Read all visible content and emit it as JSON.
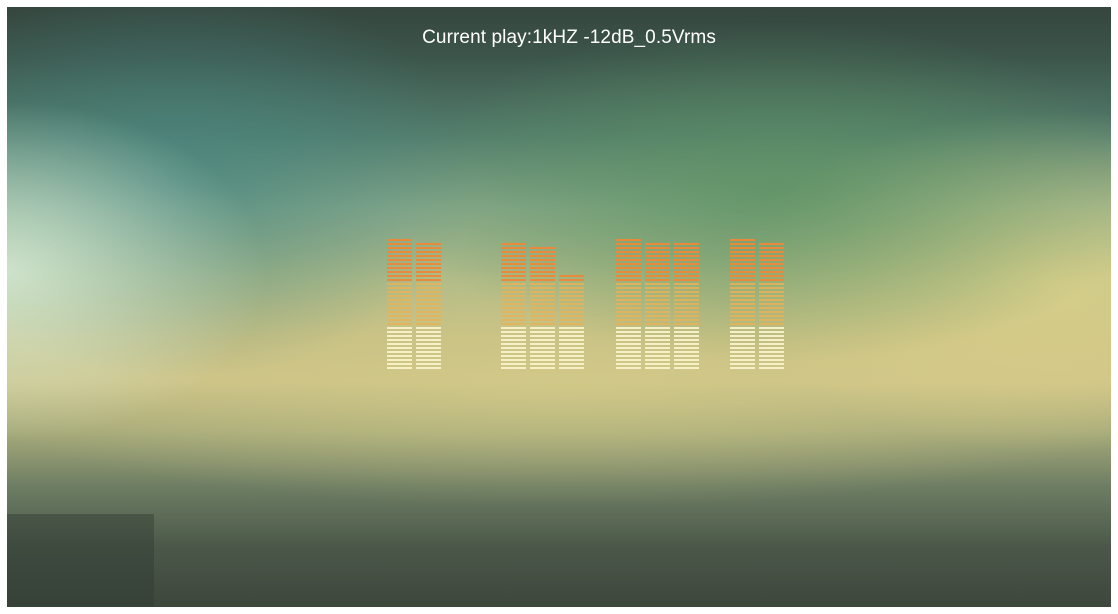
{
  "header": {
    "current_play": "Current play:1kHZ -12dB_0.5Vrms"
  },
  "level_meter": {
    "colors": {
      "low": "#f7f0c6",
      "mid": "#e7b257",
      "high": "#e9893a"
    },
    "groups": [
      {
        "bars": [
          1.0,
          0.98
        ]
      },
      {
        "bars": [
          0.98,
          0.95,
          0.74
        ]
      },
      {
        "bars": [
          1.0,
          0.96,
          0.96
        ]
      },
      {
        "bars": [
          1.0,
          0.96
        ]
      }
    ]
  }
}
